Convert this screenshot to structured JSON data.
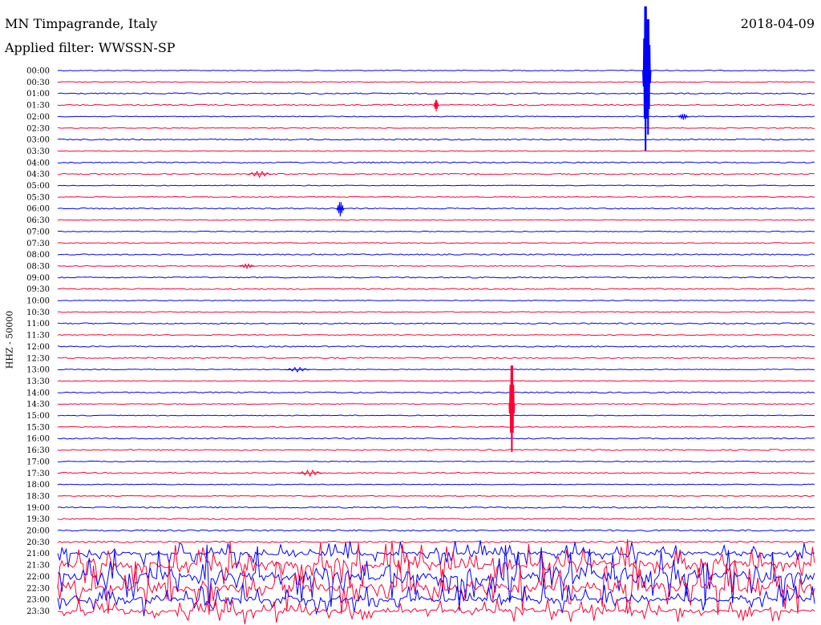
{
  "header": {
    "station": "MN Timpagrande, Italy",
    "filter": "Applied filter: WWSSN-SP",
    "date": "2018-04-09"
  },
  "chart_data": {
    "type": "line",
    "title": "MN Timpagrande, Italy",
    "subtitle": "Applied filter: WWSSN-SP",
    "ylabel": "HHZ - 50000",
    "trace_colors": [
      "#0000ff",
      "#ff0033"
    ],
    "rows": [
      "00:00",
      "00:30",
      "01:00",
      "01:30",
      "02:00",
      "02:30",
      "03:00",
      "03:30",
      "04:00",
      "04:30",
      "05:00",
      "05:30",
      "06:00",
      "06:30",
      "07:00",
      "07:30",
      "08:00",
      "08:30",
      "09:00",
      "09:30",
      "10:00",
      "10:30",
      "11:00",
      "11:30",
      "12:00",
      "12:30",
      "13:00",
      "13:30",
      "14:00",
      "14:30",
      "15:00",
      "15:30",
      "16:00",
      "16:30",
      "17:00",
      "17:30",
      "18:00",
      "18:30",
      "19:00",
      "19:30",
      "20:00",
      "20:30",
      "21:00",
      "21:30",
      "22:00",
      "22:30",
      "23:00",
      "23:30"
    ],
    "noise_level_by_row": [
      1,
      1,
      1.5,
      1.5,
      1,
      1,
      1.5,
      1,
      1.5,
      1.5,
      1,
      1,
      1.5,
      1,
      1,
      1,
      1.5,
      1,
      1.5,
      1.5,
      1,
      1,
      1.5,
      1,
      1.5,
      1.5,
      1,
      1,
      1.5,
      1,
      1,
      1,
      1.5,
      1.5,
      1,
      1.5,
      1,
      1,
      1.5,
      1.5,
      2,
      2,
      4,
      8,
      10,
      9,
      5,
      4
    ],
    "events": [
      {
        "row": 0,
        "minute": 23.3,
        "amplitude": 100,
        "width_min": 0.2
      },
      {
        "row": 0,
        "minute": 23.4,
        "amplitude": 80,
        "width_min": 0.2
      },
      {
        "row": 3,
        "minute": 15.0,
        "amplitude": 8,
        "width_min": 0.2
      },
      {
        "row": 4,
        "minute": 24.8,
        "amplitude": 4,
        "width_min": 0.4
      },
      {
        "row": 9,
        "minute": 8.0,
        "amplitude": 4,
        "width_min": 1.0
      },
      {
        "row": 12,
        "minute": 11.2,
        "amplitude": 10,
        "width_min": 0.3
      },
      {
        "row": 17,
        "minute": 7.5,
        "amplitude": 3,
        "width_min": 0.6
      },
      {
        "row": 26,
        "minute": 9.5,
        "amplitude": 3,
        "width_min": 1.0
      },
      {
        "row": 35,
        "minute": 10.0,
        "amplitude": 4,
        "width_min": 1.0
      },
      {
        "row": 29,
        "minute": 18.0,
        "amplitude": 60,
        "width_min": 0.2
      }
    ]
  }
}
